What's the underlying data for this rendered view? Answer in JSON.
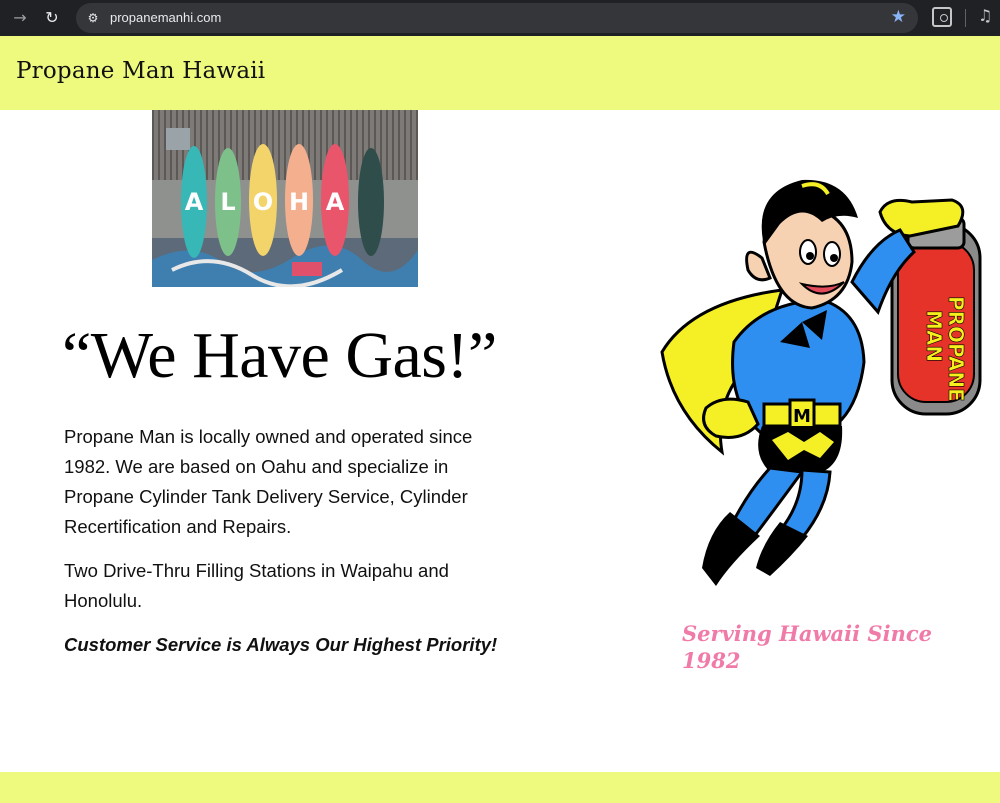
{
  "browser": {
    "back_icon": "arrow-left-icon",
    "reload_icon": "reload-icon",
    "url": "propanemanhi.com",
    "bookmark_icon": "star-icon",
    "colors": {
      "chrome_bg": "#202124",
      "omnibox_bg": "#35363a",
      "star": "#8ab4f8"
    }
  },
  "header": {
    "title": "Propane Man Hawaii",
    "bg_color": "#eefa7d"
  },
  "hero_image": {
    "sign_letters": [
      "A",
      "L",
      "O",
      "H",
      "A"
    ]
  },
  "main": {
    "headline": "“We Have Gas!”",
    "paragraph_1": "Propane Man is locally owned and operated since 1982. We are based on Oahu and specialize in Propane Cylinder Tank Delivery Service, Cylinder Recertification and Repairs.",
    "paragraph_2": "Two Drive-Thru Filling Stations in Waipahu and Honolulu.",
    "paragraph_3": "Customer Service is Always Our Highest Priority!"
  },
  "mascot": {
    "tank_label_line1": "PROPANE",
    "tank_label_line2": "MAN",
    "belt_letter": "M"
  },
  "tagline": {
    "text": "Serving Hawaii Since 1982",
    "color": "#f07aa8"
  },
  "footer": {
    "bg_color": "#eefa7d"
  }
}
